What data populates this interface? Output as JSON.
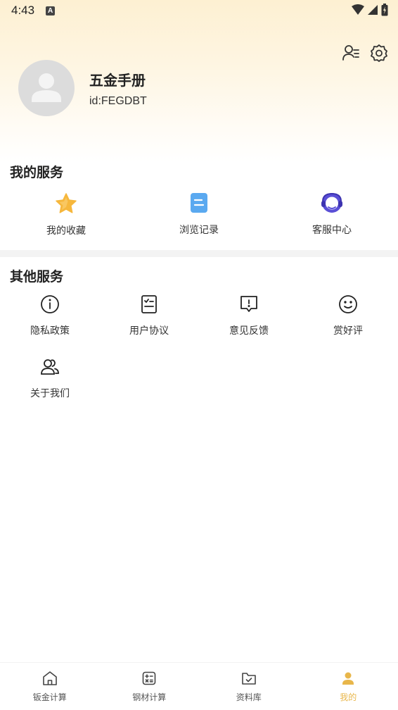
{
  "status_bar": {
    "time": "4:43",
    "notification_letter": "A"
  },
  "profile": {
    "name": "五金手册",
    "id": "id:FEGDBT"
  },
  "my_services": {
    "title": "我的服务",
    "items": [
      {
        "label": "我的收藏",
        "icon": "star-icon"
      },
      {
        "label": "浏览记录",
        "icon": "document-icon"
      },
      {
        "label": "客服中心",
        "icon": "headset-icon"
      }
    ]
  },
  "other_services": {
    "title": "其他服务",
    "items": [
      {
        "label": "隐私政策",
        "icon": "info-icon"
      },
      {
        "label": "用户协议",
        "icon": "checklist-icon"
      },
      {
        "label": "意见反馈",
        "icon": "feedback-icon"
      },
      {
        "label": "赏好评",
        "icon": "smile-icon"
      },
      {
        "label": "关于我们",
        "icon": "people-icon"
      }
    ]
  },
  "tabbar": {
    "items": [
      {
        "label": "钣金计算",
        "icon": "home-icon"
      },
      {
        "label": "钢材计算",
        "icon": "calculator-icon"
      },
      {
        "label": "资料库",
        "icon": "folder-icon"
      },
      {
        "label": "我的",
        "icon": "user-icon"
      }
    ],
    "active_index": 3
  },
  "colors": {
    "accent": "#e8b64a",
    "star": "#f6b73c",
    "doc": "#5aa9f0",
    "headset": "#5a4fd6"
  }
}
